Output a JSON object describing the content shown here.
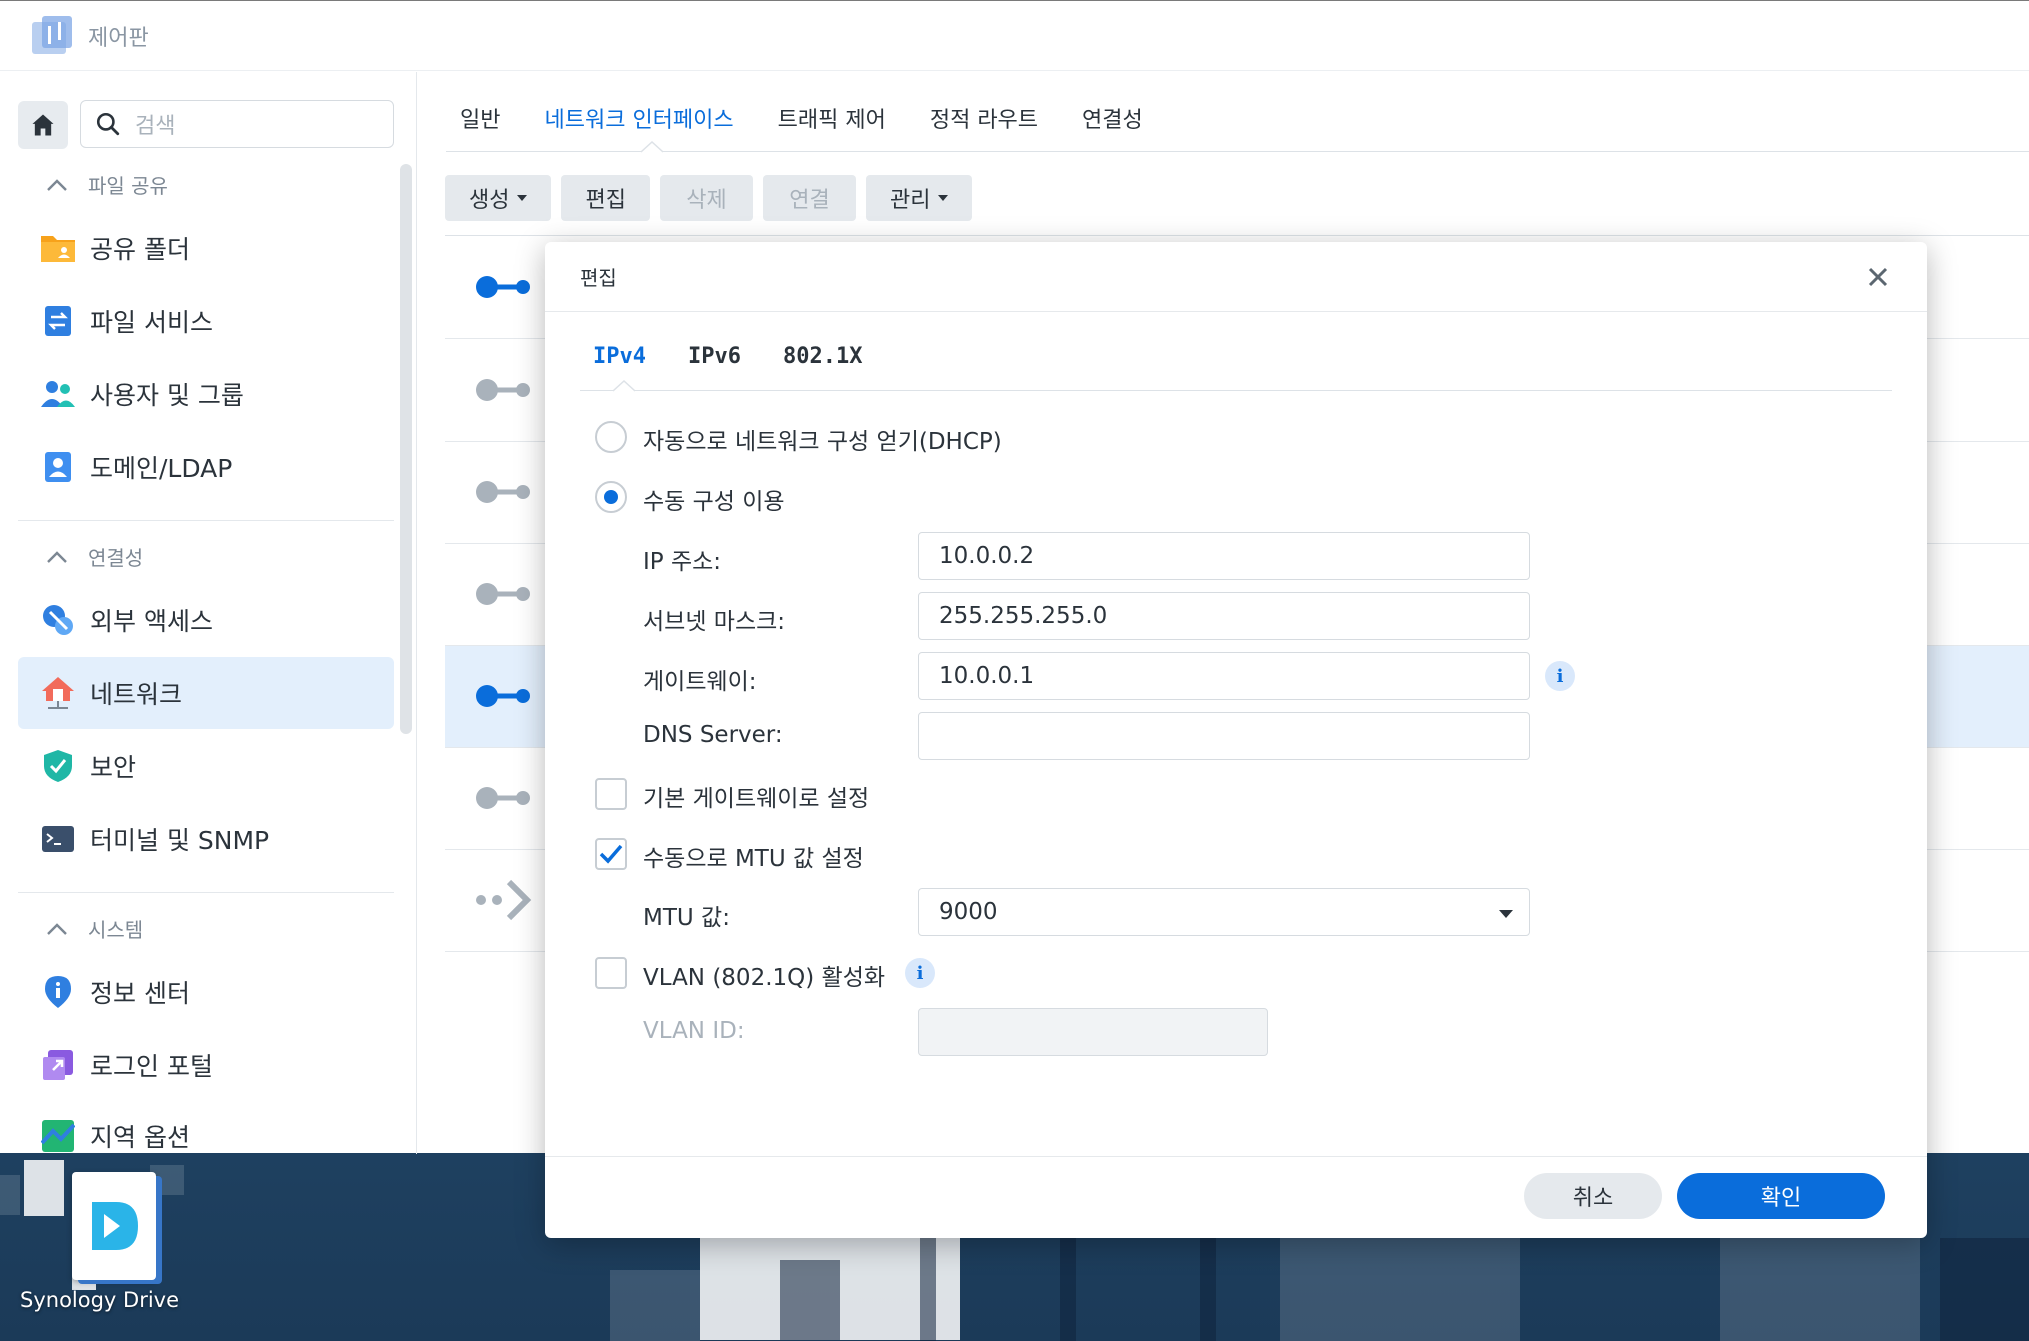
{
  "window": {
    "title": "제어판"
  },
  "sidebar": {
    "search_placeholder": "검색",
    "sections": [
      {
        "title": "파일 공유",
        "items": [
          {
            "label": "공유 폴더",
            "icon": "shared-folder-icon"
          },
          {
            "label": "파일 서비스",
            "icon": "file-services-icon"
          },
          {
            "label": "사용자 및 그룹",
            "icon": "users-groups-icon"
          },
          {
            "label": "도메인/LDAP",
            "icon": "domain-ldap-icon"
          }
        ]
      },
      {
        "title": "연결성",
        "items": [
          {
            "label": "외부 액세스",
            "icon": "external-access-icon"
          },
          {
            "label": "네트워크",
            "icon": "network-icon",
            "active": true
          },
          {
            "label": "보안",
            "icon": "security-shield-icon"
          },
          {
            "label": "터미널 및 SNMP",
            "icon": "terminal-icon"
          }
        ]
      },
      {
        "title": "시스템",
        "items": [
          {
            "label": "정보 센터",
            "icon": "info-center-icon"
          },
          {
            "label": "로그인 포털",
            "icon": "login-portal-icon"
          },
          {
            "label": "지역 옵션",
            "icon": "regional-options-icon"
          }
        ]
      }
    ]
  },
  "main": {
    "tabs": [
      {
        "label": "일반"
      },
      {
        "label": "네트워크 인터페이스",
        "active": true
      },
      {
        "label": "트래픽 제어"
      },
      {
        "label": "정적 라우트"
      },
      {
        "label": "연결성"
      }
    ],
    "toolbar": {
      "create": "생성",
      "edit": "편집",
      "delete": "삭제",
      "connect": "연결",
      "manage": "관리"
    }
  },
  "dialog": {
    "title": "편집",
    "tabs": [
      {
        "label": "IPv4",
        "active": true
      },
      {
        "label": "IPv6"
      },
      {
        "label": "802.1X"
      }
    ],
    "dhcp_label": "자동으로 네트워크 구성 얻기(DHCP)",
    "manual_label": "수동 구성 이용",
    "fields": {
      "ip_label": "IP 주소:",
      "ip_value": "10.0.0.2",
      "subnet_label": "서브넷 마스크:",
      "subnet_value": "255.255.255.0",
      "gateway_label": "게이트웨이:",
      "gateway_value": "10.0.0.1",
      "dns_label": "DNS Server:",
      "dns_value": ""
    },
    "default_gateway_label": "기본 게이트웨이로 설정",
    "mtu_manual_label": "수동으로 MTU 값 설정",
    "mtu_label": "MTU 값:",
    "mtu_value": "9000",
    "vlan_label": "VLAN (802.1Q) 활성화",
    "vlan_id_label": "VLAN ID:",
    "vlan_id_value": "",
    "cancel": "취소",
    "ok": "확인"
  },
  "desktop": {
    "app_label": "Synology Drive"
  },
  "colors": {
    "accent": "#0a6ddb",
    "selected_bg": "#e3effc"
  }
}
